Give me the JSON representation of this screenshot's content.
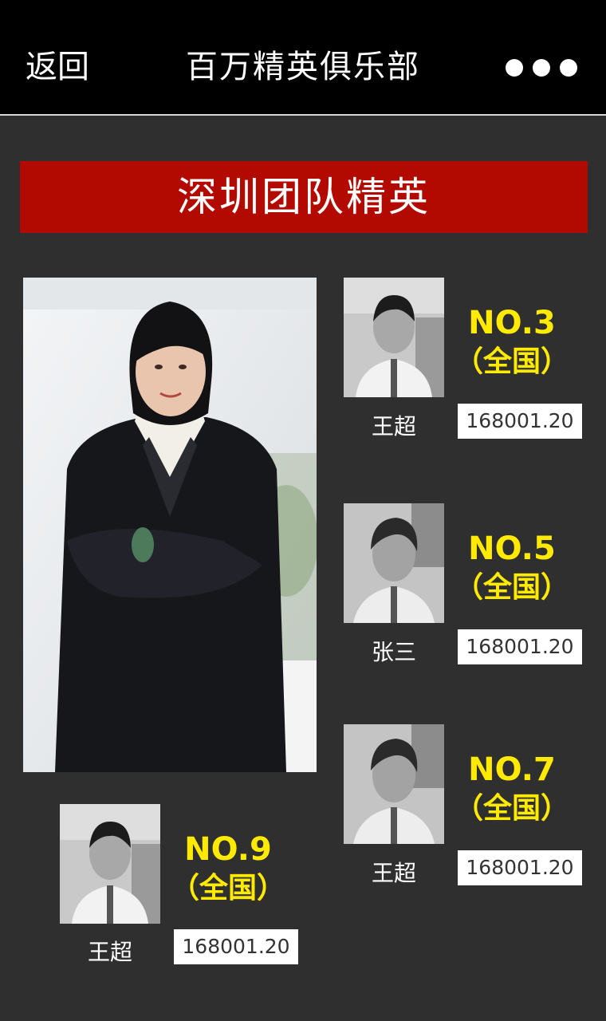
{
  "header": {
    "back_label": "返回",
    "title": "百万精英俱乐部",
    "more_icon": "more-dots-icon"
  },
  "banner": {
    "title": "深圳团队精英"
  },
  "members": [
    {
      "name": "王超",
      "rank": "NO.3",
      "scope": "（全国）",
      "score": "168001.20"
    },
    {
      "name": "张三",
      "rank": "NO.5",
      "scope": "（全国）",
      "score": "168001.20"
    },
    {
      "name": "王超",
      "rank": "NO.7",
      "scope": "（全国）",
      "score": "168001.20"
    },
    {
      "name": "王超",
      "rank": "NO.9",
      "scope": "（全国）",
      "score": "168001.20"
    }
  ],
  "colors": {
    "header_bg": "#000000",
    "page_bg": "#2f2f2f",
    "banner_bg": "#b30a00",
    "rank_text": "#ffea00",
    "score_bg": "#ffffff"
  }
}
